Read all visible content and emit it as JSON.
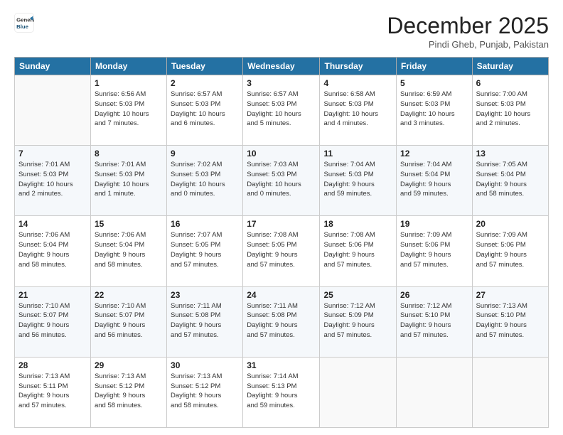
{
  "header": {
    "logo_line1": "General",
    "logo_line2": "Blue",
    "month": "December 2025",
    "location": "Pindi Gheb, Punjab, Pakistan"
  },
  "days_of_week": [
    "Sunday",
    "Monday",
    "Tuesday",
    "Wednesday",
    "Thursday",
    "Friday",
    "Saturday"
  ],
  "weeks": [
    [
      {
        "num": "",
        "info": ""
      },
      {
        "num": "1",
        "info": "Sunrise: 6:56 AM\nSunset: 5:03 PM\nDaylight: 10 hours\nand 7 minutes."
      },
      {
        "num": "2",
        "info": "Sunrise: 6:57 AM\nSunset: 5:03 PM\nDaylight: 10 hours\nand 6 minutes."
      },
      {
        "num": "3",
        "info": "Sunrise: 6:57 AM\nSunset: 5:03 PM\nDaylight: 10 hours\nand 5 minutes."
      },
      {
        "num": "4",
        "info": "Sunrise: 6:58 AM\nSunset: 5:03 PM\nDaylight: 10 hours\nand 4 minutes."
      },
      {
        "num": "5",
        "info": "Sunrise: 6:59 AM\nSunset: 5:03 PM\nDaylight: 10 hours\nand 3 minutes."
      },
      {
        "num": "6",
        "info": "Sunrise: 7:00 AM\nSunset: 5:03 PM\nDaylight: 10 hours\nand 2 minutes."
      }
    ],
    [
      {
        "num": "7",
        "info": "Sunrise: 7:01 AM\nSunset: 5:03 PM\nDaylight: 10 hours\nand 2 minutes."
      },
      {
        "num": "8",
        "info": "Sunrise: 7:01 AM\nSunset: 5:03 PM\nDaylight: 10 hours\nand 1 minute."
      },
      {
        "num": "9",
        "info": "Sunrise: 7:02 AM\nSunset: 5:03 PM\nDaylight: 10 hours\nand 0 minutes."
      },
      {
        "num": "10",
        "info": "Sunrise: 7:03 AM\nSunset: 5:03 PM\nDaylight: 10 hours\nand 0 minutes."
      },
      {
        "num": "11",
        "info": "Sunrise: 7:04 AM\nSunset: 5:03 PM\nDaylight: 9 hours\nand 59 minutes."
      },
      {
        "num": "12",
        "info": "Sunrise: 7:04 AM\nSunset: 5:04 PM\nDaylight: 9 hours\nand 59 minutes."
      },
      {
        "num": "13",
        "info": "Sunrise: 7:05 AM\nSunset: 5:04 PM\nDaylight: 9 hours\nand 58 minutes."
      }
    ],
    [
      {
        "num": "14",
        "info": "Sunrise: 7:06 AM\nSunset: 5:04 PM\nDaylight: 9 hours\nand 58 minutes."
      },
      {
        "num": "15",
        "info": "Sunrise: 7:06 AM\nSunset: 5:04 PM\nDaylight: 9 hours\nand 58 minutes."
      },
      {
        "num": "16",
        "info": "Sunrise: 7:07 AM\nSunset: 5:05 PM\nDaylight: 9 hours\nand 57 minutes."
      },
      {
        "num": "17",
        "info": "Sunrise: 7:08 AM\nSunset: 5:05 PM\nDaylight: 9 hours\nand 57 minutes."
      },
      {
        "num": "18",
        "info": "Sunrise: 7:08 AM\nSunset: 5:06 PM\nDaylight: 9 hours\nand 57 minutes."
      },
      {
        "num": "19",
        "info": "Sunrise: 7:09 AM\nSunset: 5:06 PM\nDaylight: 9 hours\nand 57 minutes."
      },
      {
        "num": "20",
        "info": "Sunrise: 7:09 AM\nSunset: 5:06 PM\nDaylight: 9 hours\nand 57 minutes."
      }
    ],
    [
      {
        "num": "21",
        "info": "Sunrise: 7:10 AM\nSunset: 5:07 PM\nDaylight: 9 hours\nand 56 minutes."
      },
      {
        "num": "22",
        "info": "Sunrise: 7:10 AM\nSunset: 5:07 PM\nDaylight: 9 hours\nand 56 minutes."
      },
      {
        "num": "23",
        "info": "Sunrise: 7:11 AM\nSunset: 5:08 PM\nDaylight: 9 hours\nand 57 minutes."
      },
      {
        "num": "24",
        "info": "Sunrise: 7:11 AM\nSunset: 5:08 PM\nDaylight: 9 hours\nand 57 minutes."
      },
      {
        "num": "25",
        "info": "Sunrise: 7:12 AM\nSunset: 5:09 PM\nDaylight: 9 hours\nand 57 minutes."
      },
      {
        "num": "26",
        "info": "Sunrise: 7:12 AM\nSunset: 5:10 PM\nDaylight: 9 hours\nand 57 minutes."
      },
      {
        "num": "27",
        "info": "Sunrise: 7:13 AM\nSunset: 5:10 PM\nDaylight: 9 hours\nand 57 minutes."
      }
    ],
    [
      {
        "num": "28",
        "info": "Sunrise: 7:13 AM\nSunset: 5:11 PM\nDaylight: 9 hours\nand 57 minutes."
      },
      {
        "num": "29",
        "info": "Sunrise: 7:13 AM\nSunset: 5:12 PM\nDaylight: 9 hours\nand 58 minutes."
      },
      {
        "num": "30",
        "info": "Sunrise: 7:13 AM\nSunset: 5:12 PM\nDaylight: 9 hours\nand 58 minutes."
      },
      {
        "num": "31",
        "info": "Sunrise: 7:14 AM\nSunset: 5:13 PM\nDaylight: 9 hours\nand 59 minutes."
      },
      {
        "num": "",
        "info": ""
      },
      {
        "num": "",
        "info": ""
      },
      {
        "num": "",
        "info": ""
      }
    ]
  ]
}
